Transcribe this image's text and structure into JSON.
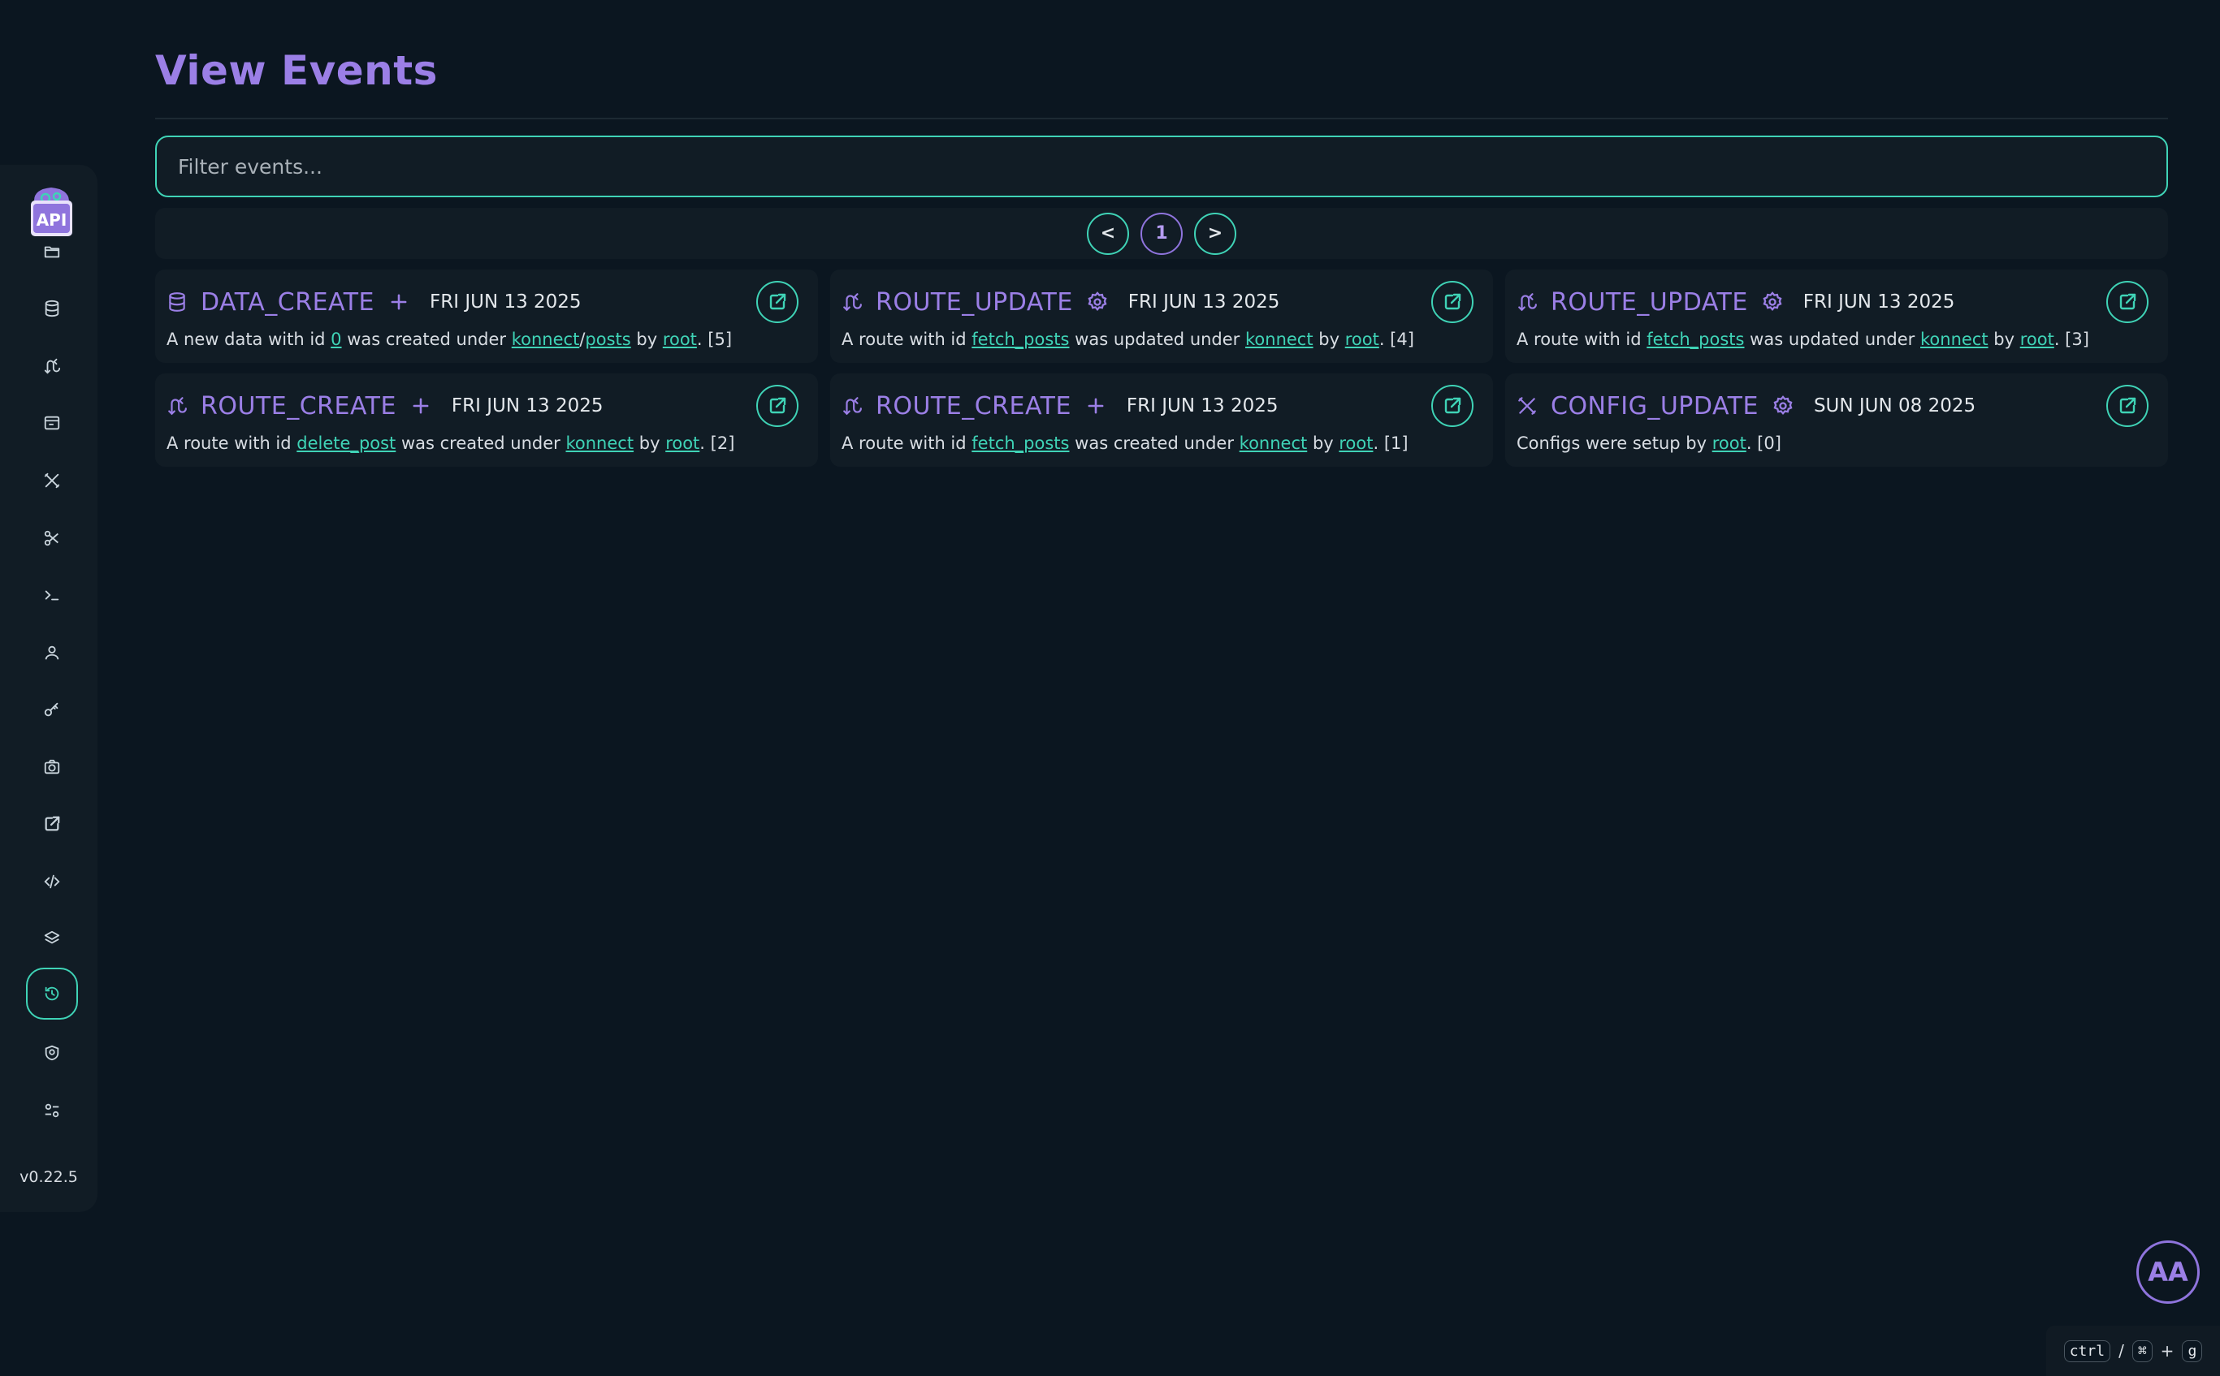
{
  "page": {
    "title": "View Events"
  },
  "filter": {
    "placeholder": "Filter events..."
  },
  "pagination": {
    "prev": "<",
    "current": "1",
    "next": ">"
  },
  "sidebar": {
    "version": "v0.22.5",
    "items": [
      {
        "name": "folder-icon"
      },
      {
        "name": "database-icon"
      },
      {
        "name": "route-icon"
      },
      {
        "name": "window-icon"
      },
      {
        "name": "tools-icon"
      },
      {
        "name": "scissors-icon"
      },
      {
        "name": "terminal-icon"
      },
      {
        "name": "user-icon"
      },
      {
        "name": "key-icon"
      },
      {
        "name": "camera-icon"
      },
      {
        "name": "external-link-icon"
      },
      {
        "name": "code-icon"
      },
      {
        "name": "layers-icon"
      },
      {
        "name": "history-icon",
        "active": true
      },
      {
        "name": "shield-icon"
      },
      {
        "name": "settings-icon"
      }
    ]
  },
  "events": [
    {
      "icon": "database-icon",
      "type": "DATA_CREATE",
      "action_icon": "plus-icon",
      "date": "FRI JUN 13 2025",
      "desc": [
        "A new data with id ",
        {
          "link": "0"
        },
        " was created under ",
        {
          "link": "konnect"
        },
        "/",
        {
          "link": "posts"
        },
        " by ",
        {
          "link": "root"
        },
        ". [5]"
      ]
    },
    {
      "icon": "route-icon",
      "type": "ROUTE_UPDATE",
      "action_icon": "gear-icon",
      "date": "FRI JUN 13 2025",
      "desc": [
        "A route with id ",
        {
          "link": "fetch_posts"
        },
        " was updated under ",
        {
          "link": "konnect"
        },
        " by ",
        {
          "link": "root"
        },
        ". [4]"
      ]
    },
    {
      "icon": "route-icon",
      "type": "ROUTE_UPDATE",
      "action_icon": "gear-icon",
      "date": "FRI JUN 13 2025",
      "desc": [
        "A route with id ",
        {
          "link": "fetch_posts"
        },
        " was updated under ",
        {
          "link": "konnect"
        },
        " by ",
        {
          "link": "root"
        },
        ". [3]"
      ]
    },
    {
      "icon": "route-icon",
      "type": "ROUTE_CREATE",
      "action_icon": "plus-icon",
      "date": "FRI JUN 13 2025",
      "desc": [
        "A route with id ",
        {
          "link": "delete_post"
        },
        " was created under ",
        {
          "link": "konnect"
        },
        " by ",
        {
          "link": "root"
        },
        ". [2]"
      ]
    },
    {
      "icon": "route-icon",
      "type": "ROUTE_CREATE",
      "action_icon": "plus-icon",
      "date": "FRI JUN 13 2025",
      "desc": [
        "A route with id ",
        {
          "link": "fetch_posts"
        },
        " was created under ",
        {
          "link": "konnect"
        },
        " by ",
        {
          "link": "root"
        },
        ". [1]"
      ]
    },
    {
      "icon": "tools-icon",
      "type": "CONFIG_UPDATE",
      "action_icon": "gear-icon",
      "date": "SUN JUN 08 2025",
      "desc": [
        "Configs were setup by ",
        {
          "link": "root"
        },
        ". [0]"
      ]
    }
  ],
  "avatar": {
    "initials": "AA"
  },
  "shortcut": {
    "key1": "ctrl",
    "sep": "/",
    "key2": "⌘",
    "plus": "+",
    "key3": "g"
  },
  "colors": {
    "accent": "#9b7fe6",
    "teal": "#3fd3b6",
    "background": "#0b1620",
    "panel": "#111c25"
  }
}
